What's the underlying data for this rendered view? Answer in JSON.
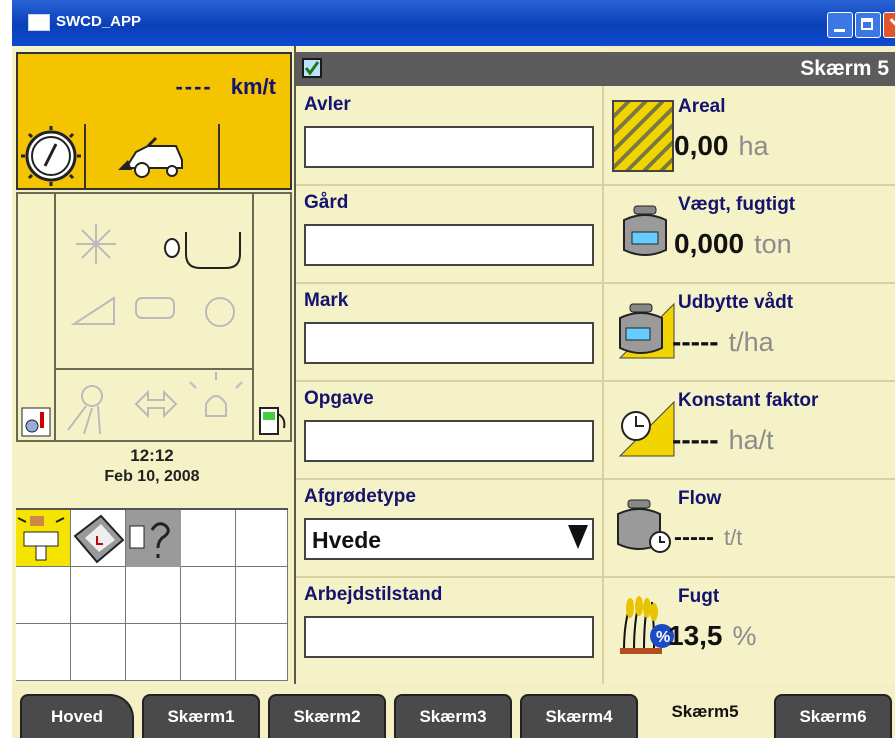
{
  "window": {
    "title": "SWCD_APP"
  },
  "left": {
    "speed": {
      "value": "----",
      "unit": "km/t"
    },
    "time": "12:12",
    "date": "Feb 10, 2008"
  },
  "header": {
    "screen_title": "Skærm 5"
  },
  "fields": [
    {
      "label": "Avler",
      "value": ""
    },
    {
      "label": "Gård",
      "value": ""
    },
    {
      "label": "Mark",
      "value": ""
    },
    {
      "label": "Opgave",
      "value": ""
    },
    {
      "label": "Afgrødetype",
      "value": "Hvede"
    },
    {
      "label": "Arbejdstilstand",
      "value": ""
    }
  ],
  "stats": [
    {
      "label": "Areal",
      "value": "0,00",
      "unit": "ha"
    },
    {
      "label": "Vægt, fugtigt",
      "value": "0,000",
      "unit": "ton"
    },
    {
      "label": "Udbytte vådt",
      "value": "-----",
      "unit": "t/ha"
    },
    {
      "label": "Konstant faktor",
      "value": "-----",
      "unit": "ha/t"
    },
    {
      "label": "Flow",
      "value": "-----",
      "unit": "t/t"
    },
    {
      "label": "Fugt",
      "value": "13,5",
      "unit": "%"
    }
  ],
  "tabs": [
    "Hoved",
    "Skærm1",
    "Skærm2",
    "Skærm3",
    "Skærm4",
    "Skærm5",
    "Skærm6"
  ],
  "active_tab": "Skærm5",
  "colors": {
    "accent_yellow": "#f5c400",
    "panel_bg": "#f6f2c8",
    "label_navy": "#14146e",
    "header_gray": "#5c5c5c",
    "titlebar_blue": "#0a3fb8"
  }
}
